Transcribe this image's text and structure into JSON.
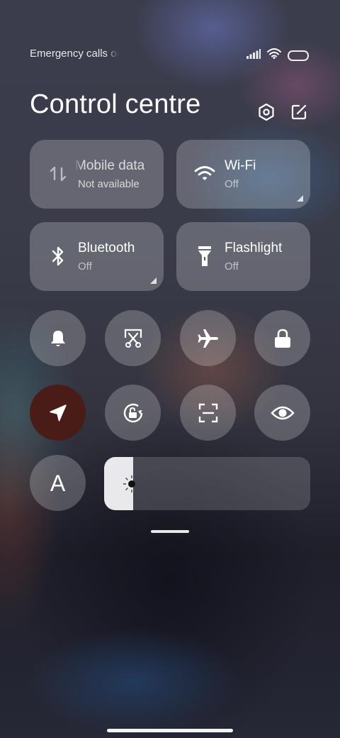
{
  "status_bar": {
    "text": "Emergency calls only",
    "icons": [
      "signal-icon",
      "wifi-icon",
      "battery-icon"
    ]
  },
  "header": {
    "title": "Control centre",
    "buttons": [
      "settings-icon",
      "edit-icon"
    ]
  },
  "tiles": [
    {
      "label": "Mobile data",
      "sub": "Not available",
      "icon": "mobile-data-icon",
      "active": false
    },
    {
      "label": "Wi-Fi",
      "sub": "Off",
      "icon": "wifi-icon",
      "active": false
    },
    {
      "label": "Bluetooth",
      "sub": "Off",
      "icon": "bluetooth-icon",
      "active": false
    },
    {
      "label": "Flashlight",
      "sub": "Off",
      "icon": "flashlight-icon",
      "active": false
    }
  ],
  "toggles_row1": [
    "bell-icon",
    "screenshot-crop-icon",
    "airplane-icon",
    "lock-icon"
  ],
  "toggles_row2": [
    "location-icon",
    "auto-rotate-icon",
    "scan-icon",
    "eye-icon"
  ],
  "font_button": {
    "letter": "A"
  },
  "brightness": {
    "level": 0.14
  },
  "colors": {
    "tile_bg": "#ffffff38",
    "location_active": "#4a1c18",
    "brightness_fill": "#e9e9ec"
  }
}
